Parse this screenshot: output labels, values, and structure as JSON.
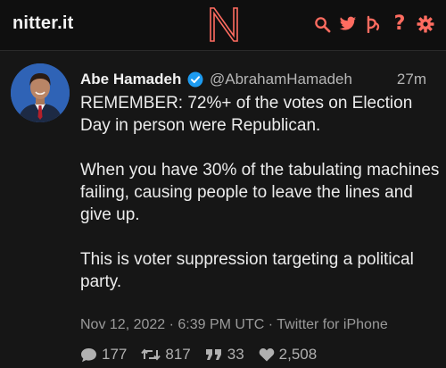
{
  "nav": {
    "brand": "nitter.it",
    "logo_icon": "nitter-logo-icon",
    "icons": [
      "search-icon",
      "twitter-bird-icon",
      "rss-feed-icon",
      "question-mark-icon",
      "gear-icon"
    ],
    "question_glyph": "?",
    "accent_color": "#ff6c60"
  },
  "tweet": {
    "fullname": "Abe Hamadeh",
    "username": "@AbrahamHamadeh",
    "time": "27m",
    "verified_icon": "verified-check-icon",
    "paragraphs": [
      "REMEMBER: 72%+ of the votes on Election Day in person were Republican.",
      "When you have 30% of the tabulating machines failing, causing people to leave the lines and give up.",
      "This is voter suppression targeting a political party."
    ],
    "published": "Nov 12, 2022 · 6:39 PM UTC · Twitter for iPhone",
    "stats": {
      "replies": "177",
      "retweets": "817",
      "quotes": "33",
      "likes": "2,508"
    }
  }
}
